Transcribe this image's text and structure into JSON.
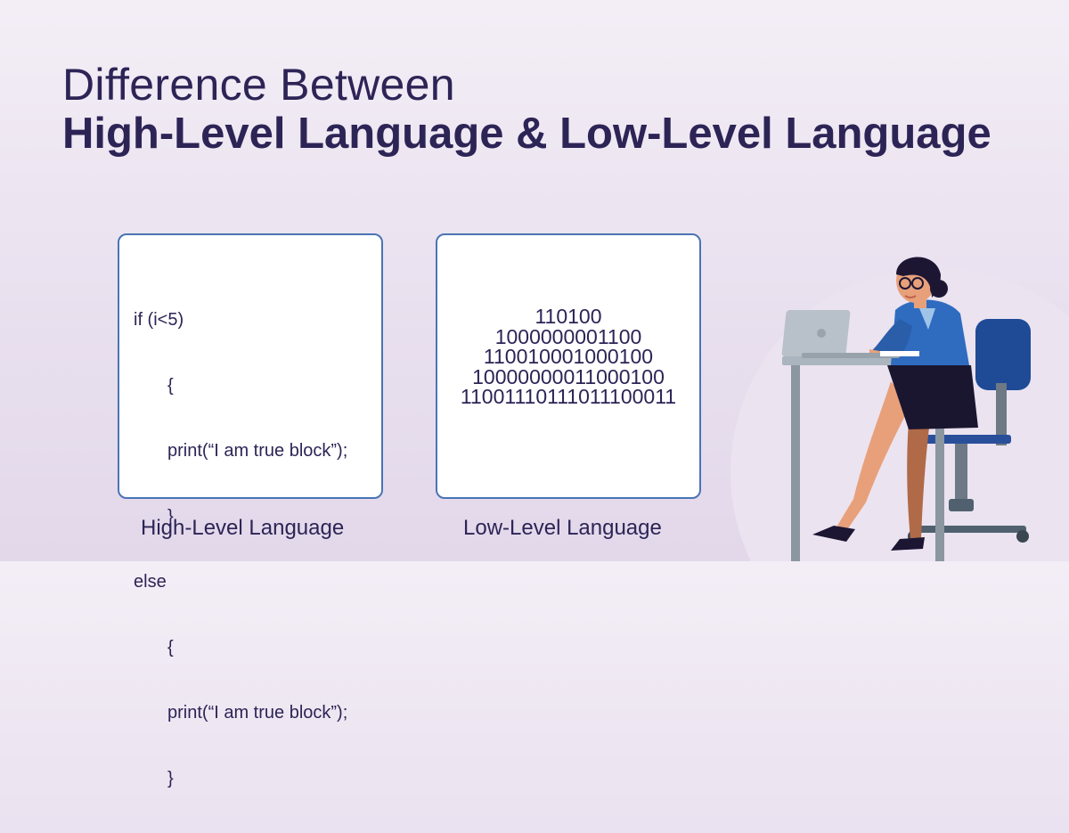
{
  "title": {
    "line1": "Difference Between",
    "line2": "High-Level Language & Low-Level Language"
  },
  "high_level": {
    "code_lines": [
      "if (i<5)",
      "{",
      "print(“I am true block”);",
      "}",
      "else",
      "{",
      "print(“I am true block”);",
      "}"
    ],
    "caption": "High-Level Language"
  },
  "low_level": {
    "binary_lines": [
      "110100",
      "1000000001100",
      "110010001000100",
      "10000000011000100",
      "11001110111011100011"
    ],
    "caption": "Low-Level Language"
  },
  "colors": {
    "title": "#2d2456",
    "card_border": "#4a74b4",
    "background": "#efe8f3"
  },
  "illustration": "woman-working-on-laptop-illustration"
}
